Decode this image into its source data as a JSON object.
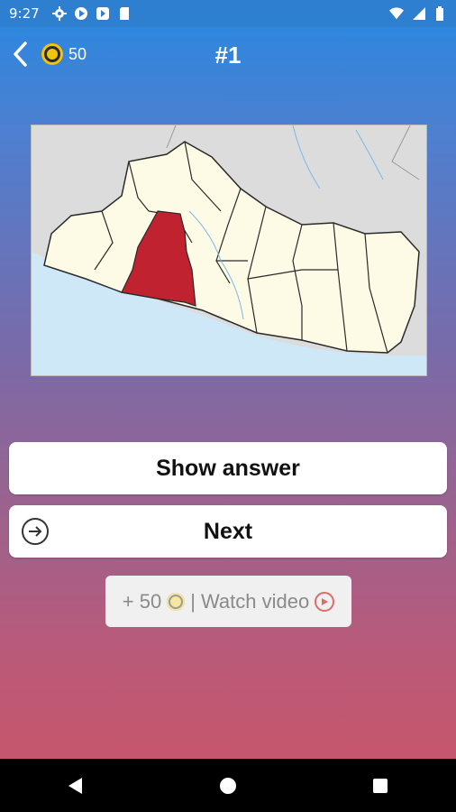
{
  "status_bar": {
    "time": "9:27",
    "left_icons": [
      "gear-icon",
      "play-circle-icon",
      "play-store-icon",
      "sd-card-icon"
    ],
    "right_icons": [
      "wifi-icon",
      "signal-icon",
      "battery-icon"
    ]
  },
  "header": {
    "coins": "50",
    "question_title": "#1"
  },
  "map": {
    "highlight_color": "#c0232f",
    "land_color": "#fdfbe6",
    "sea_color": "#cfe8f8",
    "neighbor_color": "#dcdcdc"
  },
  "buttons": {
    "show_answer": "Show answer",
    "next": "Next"
  },
  "reward": {
    "amount": "+ 50",
    "separator": "|",
    "watch_label": "Watch video"
  },
  "nav": {
    "back": "back-triangle-icon",
    "home": "home-circle-icon",
    "recents": "recents-square-icon"
  },
  "colors": {
    "accent_top": "#2f86de",
    "accent_bottom": "#c6566d",
    "coin": "#f1c40f"
  }
}
